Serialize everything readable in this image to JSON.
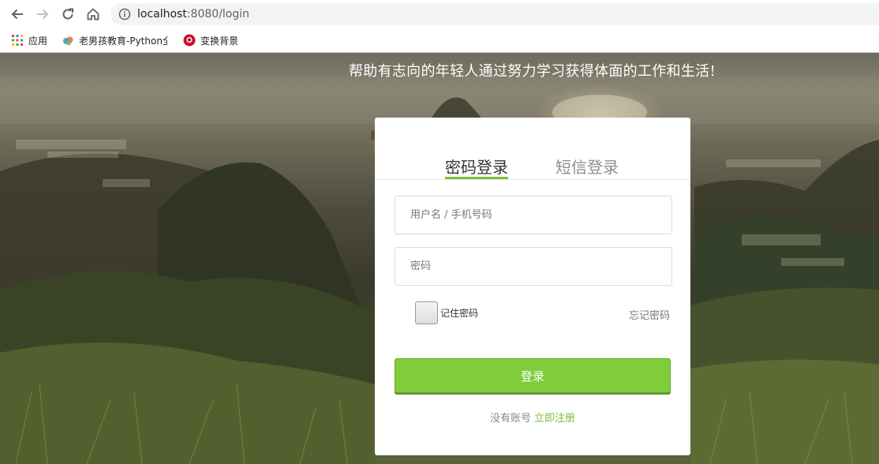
{
  "browser": {
    "url_host": "localhost",
    "url_rest": ":8080/login",
    "bookmarks": [
      {
        "label": "应用",
        "icon": "apps-grid-icon"
      },
      {
        "label": "老男孩教育-Python全",
        "icon": "cloud-icon"
      },
      {
        "label": "变换背景",
        "icon": "red-circle-icon"
      }
    ]
  },
  "page": {
    "tagline": "帮助有志向的年轻人通过努力学习获得体面的工作和生活!"
  },
  "login": {
    "tabs": [
      {
        "label": "密码登录",
        "active": true
      },
      {
        "label": "短信登录",
        "active": false
      }
    ],
    "username_placeholder": "用户名 / 手机号码",
    "password_placeholder": "密码",
    "remember_label": "记住密码",
    "forgot_label": "忘记密码",
    "submit_label": "登录",
    "no_account_text": "没有账号",
    "register_label": "立即注册"
  },
  "colors": {
    "accent": "#7fcd3a",
    "link": "#7cc13b"
  }
}
